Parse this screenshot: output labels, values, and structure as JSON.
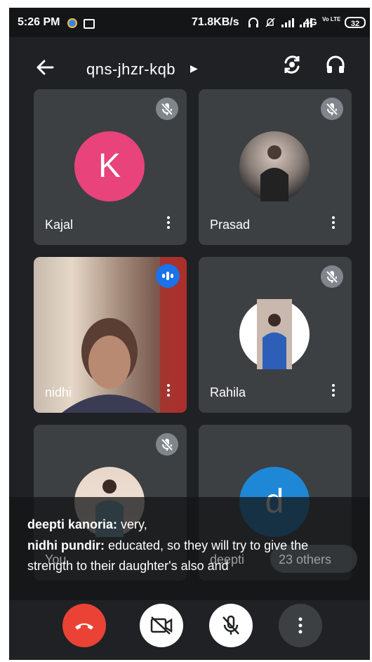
{
  "status_bar": {
    "time": "5:26 PM",
    "network_speed": "71.8KB/s",
    "network_type": "4G",
    "volte": "Vo LTE",
    "battery": "32"
  },
  "header": {
    "meeting_code": "qns-jhzr-kqb"
  },
  "participants": [
    {
      "name": "Kajal",
      "avatar_letter": "K",
      "avatar_color": "#e8437a",
      "muted": true
    },
    {
      "name": "Prasad",
      "muted": true
    },
    {
      "name": "nidhi",
      "muted": false,
      "speaking": true
    },
    {
      "name": "Rahila",
      "muted": true
    },
    {
      "name": "You",
      "muted": true
    },
    {
      "name": "deepti",
      "avatar_letter": "d",
      "avatar_color": "#1e88d6",
      "extra": "23 others"
    }
  ],
  "captions": [
    {
      "speaker": "deepti kanoria:",
      "text": "very,"
    },
    {
      "speaker": "nidhi pundir:",
      "text": "educated, so they will try to give the"
    },
    {
      "speaker": "",
      "text": "strength to their daughter's also and"
    }
  ],
  "colors": {
    "end_call": "#ea4335",
    "background": "#202124",
    "tile": "#3c4043"
  }
}
